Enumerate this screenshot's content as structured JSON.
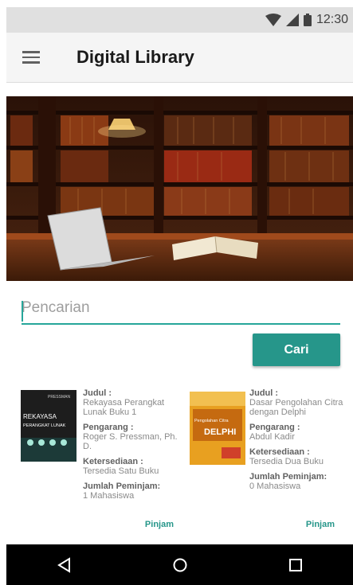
{
  "status": {
    "time": "12:30"
  },
  "app": {
    "title": "Digital Library"
  },
  "search": {
    "placeholder": "Pencarian",
    "value": "",
    "button": "Cari"
  },
  "books": [
    {
      "cover_title": "REKAYASA PERANGKAT LUNAK",
      "cover_author": "PRESSMAN",
      "judul_label": "Judul :",
      "judul": "Rekayasa Perangkat Lunak Buku 1",
      "pengarang_label": "Pengarang :",
      "pengarang": "Roger S. Pressman, Ph. D.",
      "ketersediaan_label": "Ketersediaan :",
      "ketersediaan": "Tersedia Satu Buku",
      "jumlah_label": "Jumlah Peminjam:",
      "jumlah": "1 Mahasiswa",
      "action": "Pinjam"
    },
    {
      "cover_title": "Pengolahan Citra DELPHI",
      "cover_author": "",
      "judul_label": "Judul :",
      "judul": "Dasar Pengolahan Citra dengan Delphi",
      "pengarang_label": "Pengarang :",
      "pengarang": "Abdul Kadir",
      "ketersediaan_label": "Ketersediaan :",
      "ketersediaan": "Tersedia Dua Buku",
      "jumlah_label": "Jumlah Peminjam:",
      "jumlah": "0 Mahasiswa",
      "action": "Pinjam"
    }
  ],
  "colors": {
    "accent": "#26968a",
    "appbar": "#f5f5f5",
    "statusbar": "#e0e0e0",
    "navbar": "#000000"
  },
  "icons": {
    "status": [
      "wifi-icon",
      "signal-icon",
      "battery-icon"
    ],
    "nav": [
      "back-icon",
      "home-icon",
      "recents-icon"
    ],
    "menu": "hamburger-menu-icon"
  }
}
